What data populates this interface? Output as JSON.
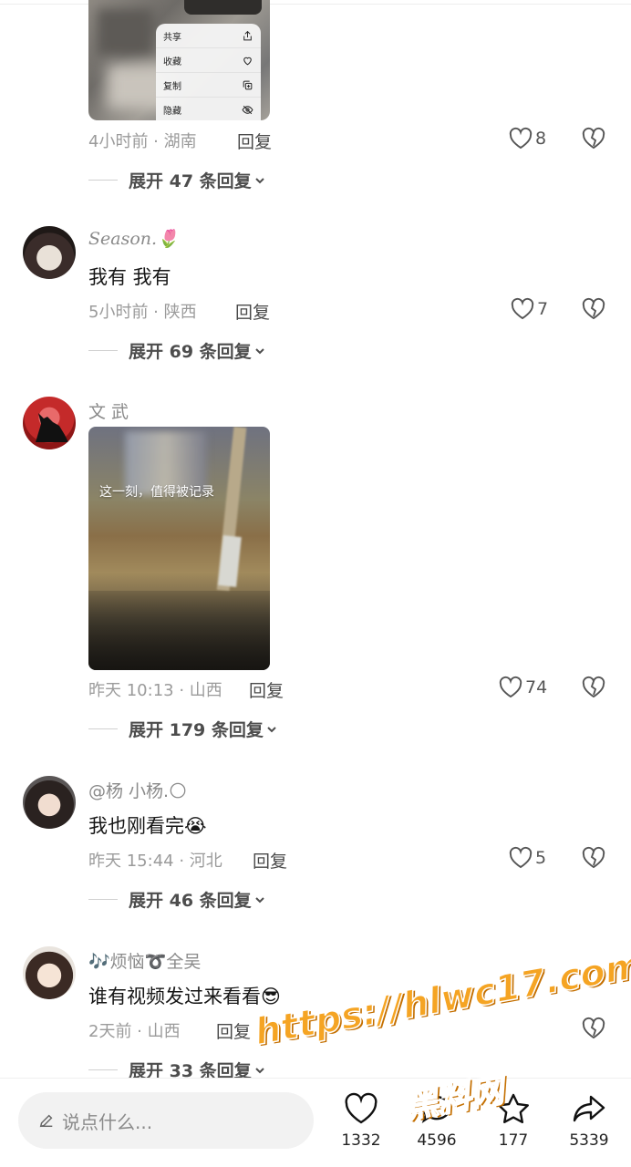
{
  "context_menu": {
    "items": [
      {
        "label": "共享",
        "icon": "share-icon"
      },
      {
        "label": "收藏",
        "icon": "heart-icon"
      },
      {
        "label": "复制",
        "icon": "copy-icon"
      },
      {
        "label": "隐藏",
        "icon": "eye-off-icon"
      }
    ]
  },
  "comments": [
    {
      "meta": "4小时前 · 湖南",
      "reply_label": "回复",
      "likes": "8",
      "expand_label": "展开 47 条回复"
    },
    {
      "username": "Season.🌷",
      "content": "我有 我有",
      "meta": "5小时前 · 陕西",
      "reply_label": "回复",
      "likes": "7",
      "expand_label": "展开 69 条回复"
    },
    {
      "username": "文 武",
      "video_caption": "这一刻，值得被记录",
      "meta": "昨天 10:13 · 山西",
      "reply_label": "回复",
      "likes": "74",
      "expand_label": "展开 179 条回复"
    },
    {
      "username": "@杨 小杨.🌕",
      "content": "我也刚看完😭",
      "meta": "昨天 15:44 · 河北",
      "reply_label": "回复",
      "likes": "5",
      "expand_label": "展开 46 条回复"
    },
    {
      "username": "🎶烦恼➰全吴",
      "content": "谁有视频发过来看看😎",
      "meta": "2天前 · 山西",
      "reply_label": "回复",
      "expand_label": "展开 33 条回复"
    }
  ],
  "bottom_bar": {
    "input_placeholder": "说点什么...",
    "actions": [
      {
        "icon": "heart-icon",
        "count": "1332"
      },
      {
        "icon": "comment-icon",
        "count": "4596"
      },
      {
        "icon": "star-icon",
        "count": "177"
      },
      {
        "icon": "share-arrow-icon",
        "count": "5339"
      }
    ]
  },
  "watermark": {
    "url": "https://hlwc17.com",
    "name": "黑料网"
  },
  "colors": {
    "accent_watermark": "#f5a423",
    "meta_text": "#9b9b9b",
    "username_text": "#8a8a8a"
  }
}
